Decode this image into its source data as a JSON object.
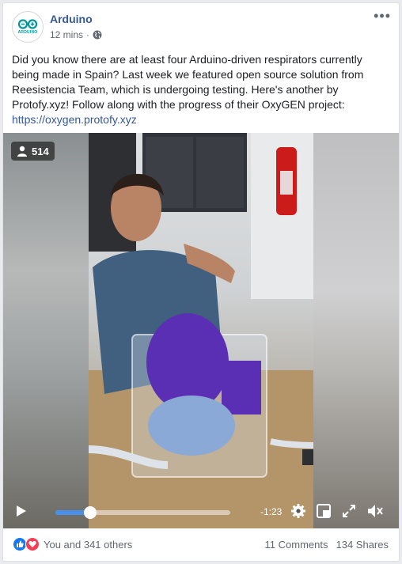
{
  "page": {
    "name": "Arduino",
    "time": "12 mins",
    "logo_text": "ARDUINO"
  },
  "post": {
    "text": "Did you know there are at least four Arduino-driven respirators currently being made in Spain? Last week we featured open source solution from Reesistencia Team, which is undergoing testing. Here's another by Protofy.xyz! Follow along with the progress of their OxyGEN project:",
    "link": "https://oxygen.protofy.xyz"
  },
  "video": {
    "viewers": "514",
    "time_remaining": "-1:23",
    "progress": 0.2
  },
  "footer": {
    "reactions_text": "You and 341 others",
    "comments": "11 Comments",
    "shares": "134 Shares"
  },
  "colors": {
    "link": "#365899",
    "like": "#1877f2",
    "love": "#f33e58",
    "brand": "#00979c"
  }
}
